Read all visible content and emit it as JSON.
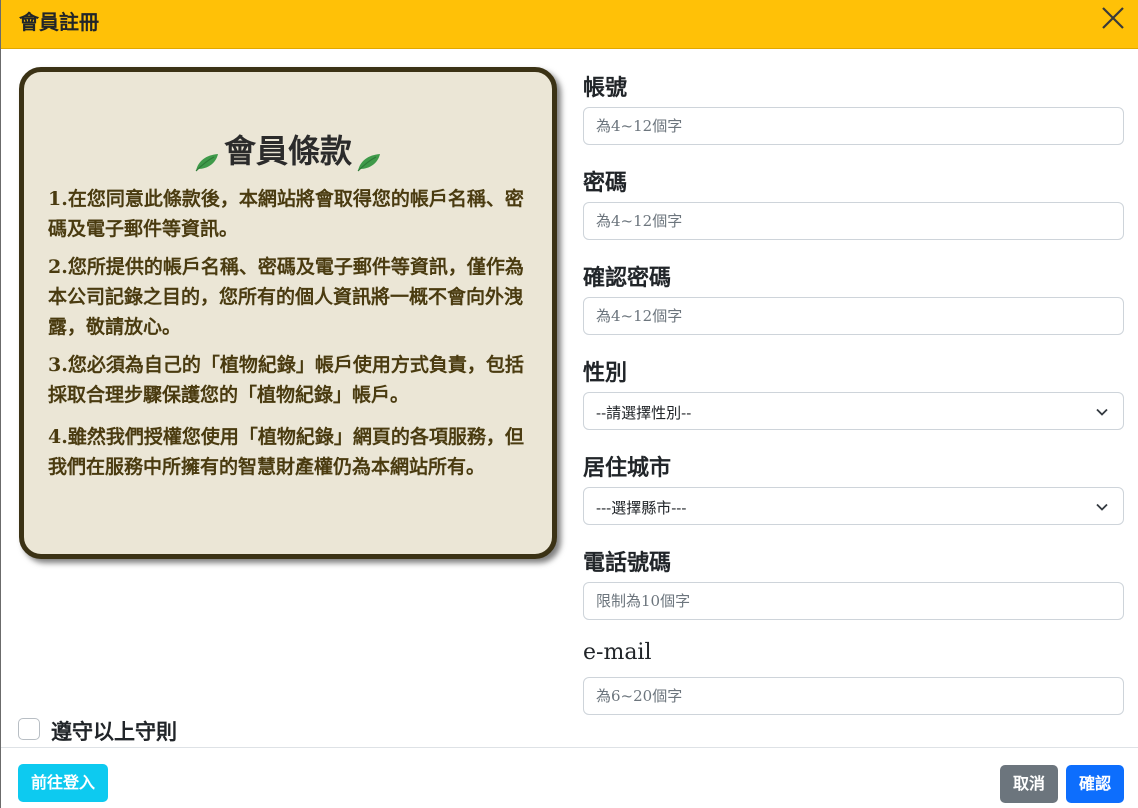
{
  "header": {
    "title": "會員註冊",
    "close_icon": "close-icon"
  },
  "terms": {
    "title": "會員條款",
    "items": [
      "1.在您同意此條款後，本網站將會取得您的帳戶名稱、密碼及電子郵件等資訊。",
      "2.您所提供的帳戶名稱、密碼及電子郵件等資訊，僅作為本公司記錄之目的，您所有的個人資訊將一概不會向外洩露，敬請放心。",
      "3.您必須為自己的「植物紀錄」帳戶使用方式負責，包括採取合理步驟保護您的「植物紀錄」帳戶。",
      "4.雖然我們授權您使用「植物紀錄」網頁的各項服務，但我們在服務中所擁有的智慧財產權仍為本網站所有。"
    ]
  },
  "form": {
    "account": {
      "label": "帳號",
      "placeholder": "為4~12個字"
    },
    "password": {
      "label": "密碼",
      "placeholder": "為4~12個字"
    },
    "confirm_password": {
      "label": "確認密碼",
      "placeholder": "為4~12個字"
    },
    "gender": {
      "label": "性別",
      "selected": "--請選擇性別--"
    },
    "city": {
      "label": "居住城市",
      "selected": "---選擇縣市---"
    },
    "phone": {
      "label": "電話號碼",
      "placeholder": "限制為10個字"
    },
    "email": {
      "label": "e-mail",
      "placeholder": "為6~20個字"
    }
  },
  "agree": {
    "label": "遵守以上守則",
    "checked": false
  },
  "footer": {
    "login_label": "前往登入",
    "cancel_label": "取消",
    "confirm_label": "確認"
  },
  "colors": {
    "header_bg": "#ffc107",
    "card_bg": "#ebe6d6",
    "card_border": "#3b3215",
    "login_btn": "#0dcaf0",
    "cancel_btn": "#6c757d",
    "confirm_btn": "#0d6efd"
  }
}
